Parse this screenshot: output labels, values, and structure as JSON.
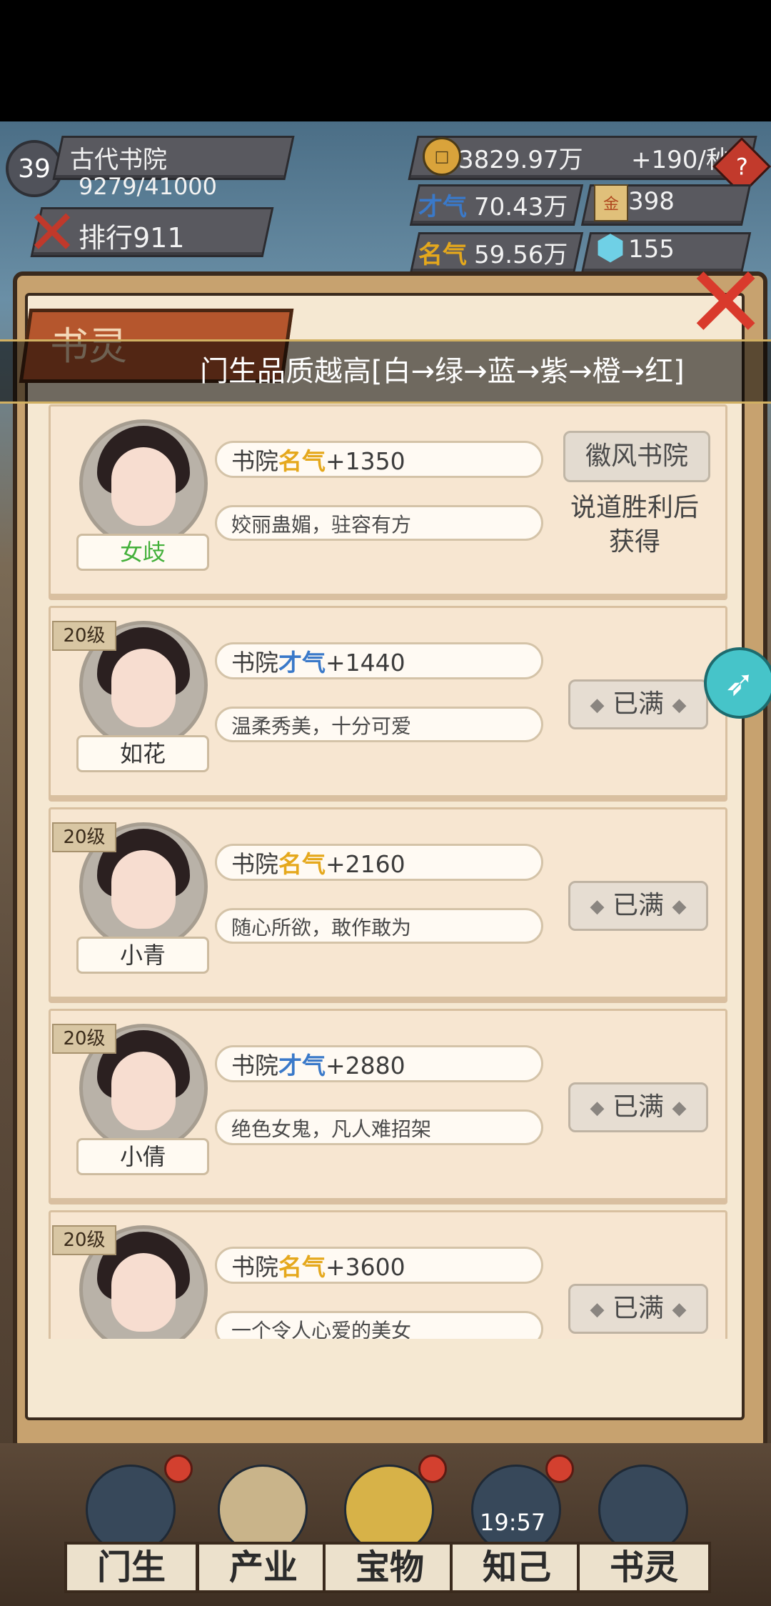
{
  "hud": {
    "level": "39",
    "academy_name": "古代书院",
    "exp": "9279/41000",
    "rank_label": "排行911",
    "coins": "3829.97万",
    "coin_rate": "+190/秒",
    "talent_label": "才气",
    "talent_value": "70.43万",
    "fame_label": "名气",
    "fame_value": "59.56万",
    "ticket_value": "398",
    "gem_value": "155",
    "help_icon": "?"
  },
  "panel": {
    "title": "书灵",
    "marquee": "门生品质越高[白→绿→蓝→紫→橙→红]",
    "close_icon": "✕"
  },
  "cards": [
    {
      "level": "",
      "name": "女歧",
      "name_color": "#43b03a",
      "stat_prefix": "书院",
      "stat_kind": "名气",
      "stat_value": "+1350",
      "desc": "姣丽蛊媚，驻容有方",
      "right_button": "徽风书院",
      "right_text": "说道胜利后获得"
    },
    {
      "level": "20级",
      "name": "如花",
      "name_color": "#333333",
      "stat_prefix": "书院",
      "stat_kind": "才气",
      "stat_value": "+1440",
      "desc": "温柔秀美，十分可爱",
      "right_button": "已满"
    },
    {
      "level": "20级",
      "name": "小青",
      "name_color": "#333333",
      "stat_prefix": "书院",
      "stat_kind": "名气",
      "stat_value": "+2160",
      "desc": "随心所欲，敢作敢为",
      "right_button": "已满"
    },
    {
      "level": "20级",
      "name": "小倩",
      "name_color": "#333333",
      "stat_prefix": "书院",
      "stat_kind": "才气",
      "stat_value": "+2880",
      "desc": "绝色女鬼，凡人难招架",
      "right_button": "已满"
    },
    {
      "level": "20级",
      "name": "",
      "name_color": "#333333",
      "stat_prefix": "书院",
      "stat_kind": "名气",
      "stat_value": "+3600",
      "desc": "一个令人心爱的美女",
      "right_button": "已满"
    }
  ],
  "nav": {
    "items": [
      "门生",
      "产业",
      "宝物",
      "知己",
      "书灵"
    ],
    "clock": "19:57"
  },
  "colors": {
    "fame": "#e5a81c",
    "talent": "#3a79c9",
    "close": "#d93a2c",
    "rocket": "#46c4c9"
  },
  "icons": {
    "rocket": "rocket-icon",
    "coin": "coin-icon",
    "gem": "gem-icon",
    "ticket": "ticket-icon"
  }
}
